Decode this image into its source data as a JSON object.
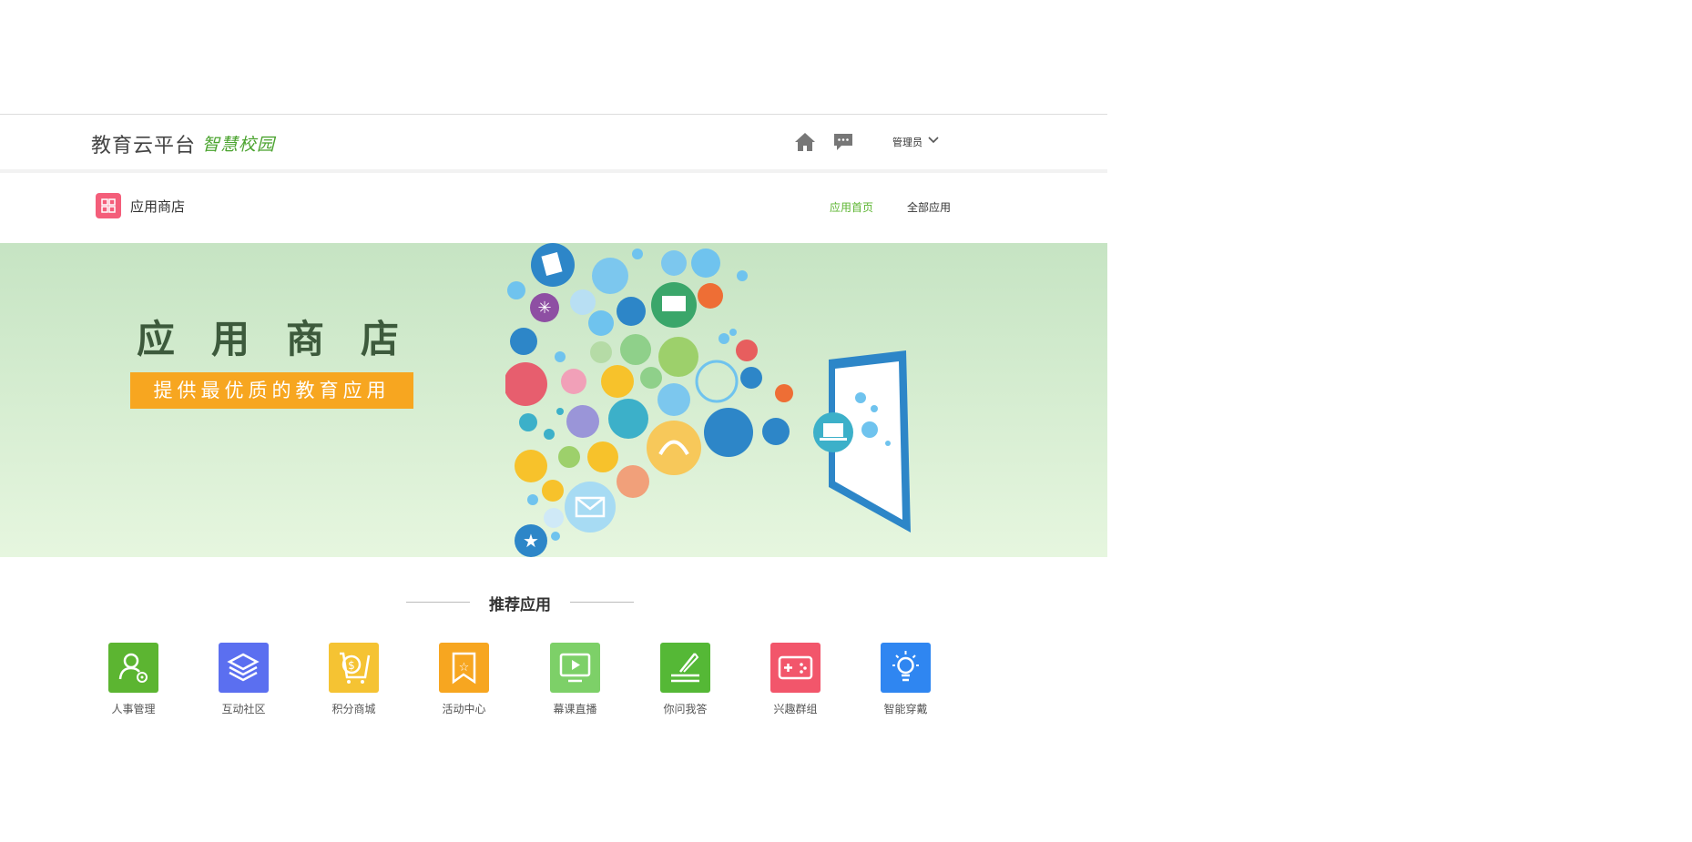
{
  "header": {
    "logo_main": "教育云平台",
    "logo_sub": "智慧校园",
    "admin_label": "管理员"
  },
  "icons": {
    "home": "home-icon",
    "message": "message-icon",
    "dropdown": "chevron-down-icon",
    "store": "grid-icon"
  },
  "subnav": {
    "store_title": "应用商店",
    "links": [
      {
        "label": "应用首页",
        "active": true
      },
      {
        "label": "全部应用",
        "active": false
      }
    ]
  },
  "banner": {
    "title": "应用商店",
    "tagline": "提供最优质的教育应用"
  },
  "recommended": {
    "title": "推荐应用",
    "apps": [
      {
        "label": "人事管理",
        "color": "#5cb531",
        "icon": "user-gear-icon"
      },
      {
        "label": "互动社区",
        "color": "#5b6ff0",
        "icon": "layers-icon"
      },
      {
        "label": "积分商城",
        "color": "#f5c333",
        "icon": "cart-icon"
      },
      {
        "label": "活动中心",
        "color": "#f7a620",
        "icon": "star-bookmark-icon"
      },
      {
        "label": "幕课直播",
        "color": "#7dd068",
        "icon": "play-screen-icon"
      },
      {
        "label": "你问我答",
        "color": "#55b836",
        "icon": "pen-icon"
      },
      {
        "label": "兴趣群组",
        "color": "#f2566b",
        "icon": "gamepad-icon"
      },
      {
        "label": "智能穿戴",
        "color": "#2f86f1",
        "icon": "bulb-icon"
      }
    ]
  },
  "colors": {
    "accent": "#5cb531",
    "badge": "#f45e7a",
    "tag": "#f7a620"
  }
}
